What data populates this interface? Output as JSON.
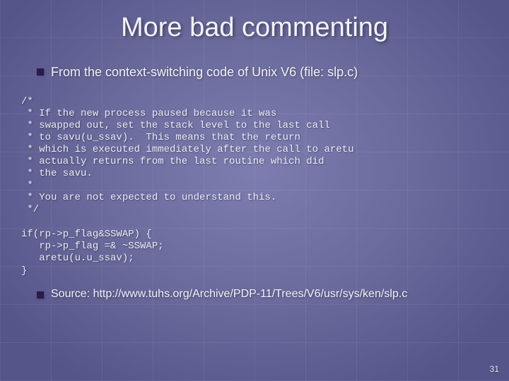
{
  "title": "More bad commenting",
  "bullets": {
    "context": "From the context-switching code of Unix V6 (file: slp.c)",
    "source": "Source: http://www.tuhs.org/Archive/PDP-11/Trees/V6/usr/sys/ken/slp.c"
  },
  "code": {
    "comment": "/*\n * If the new process paused because it was\n * swapped out, set the stack level to the last call\n * to savu(u_ssav).  This means that the return\n * which is executed immediately after the call to aretu\n * actually returns from the last routine which did\n * the savu.\n *\n * You are not expected to understand this.\n */",
    "snippet": "if(rp->p_flag&SSWAP) {\n   rp->p_flag =& ~SSWAP;\n   aretu(u.u_ssav);\n}"
  },
  "page_number": "31"
}
